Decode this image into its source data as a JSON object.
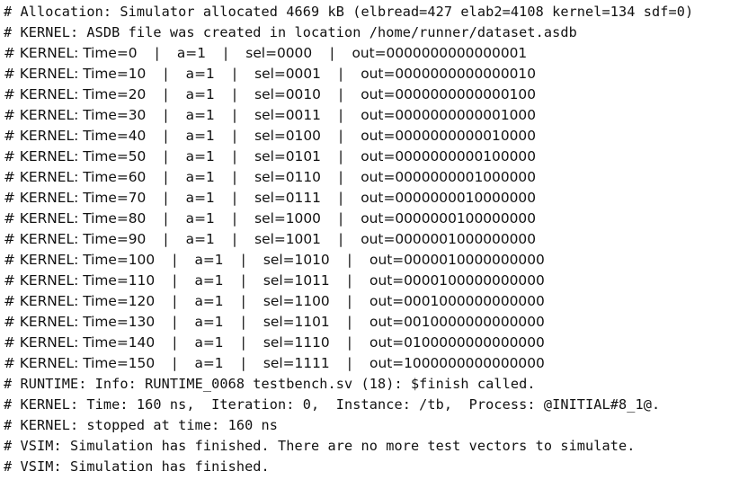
{
  "console": {
    "lines": [
      "# Allocation: Simulator allocated 4669 kB (elbread=427 elab2=4108 kernel=134 sdf=0)",
      "# KERNEL: ASDB file was created in location /home/runner/dataset.asdb",
      "# KERNEL: Time=0    |    a=1    |    sel=0000    |    out=0000000000000001",
      "# KERNEL: Time=10    |    a=1    |    sel=0001    |    out=0000000000000010",
      "# KERNEL: Time=20    |    a=1    |    sel=0010    |    out=0000000000000100",
      "# KERNEL: Time=30    |    a=1    |    sel=0011    |    out=0000000000001000",
      "# KERNEL: Time=40    |    a=1    |    sel=0100    |    out=0000000000010000",
      "# KERNEL: Time=50    |    a=1    |    sel=0101    |    out=0000000000100000",
      "# KERNEL: Time=60    |    a=1    |    sel=0110    |    out=0000000001000000",
      "# KERNEL: Time=70    |    a=1    |    sel=0111    |    out=0000000010000000",
      "# KERNEL: Time=80    |    a=1    |    sel=1000    |    out=0000000100000000",
      "# KERNEL: Time=90    |    a=1    |    sel=1001    |    out=0000001000000000",
      "# KERNEL: Time=100    |    a=1    |    sel=1010    |    out=0000010000000000",
      "# KERNEL: Time=110    |    a=1    |    sel=1011    |    out=0000100000000000",
      "# KERNEL: Time=120    |    a=1    |    sel=1100    |    out=0001000000000000",
      "# KERNEL: Time=130    |    a=1    |    sel=1101    |    out=0010000000000000",
      "# KERNEL: Time=140    |    a=1    |    sel=1110    |    out=0100000000000000",
      "# KERNEL: Time=150    |    a=1    |    sel=1111    |    out=1000000000000000",
      "# RUNTIME: Info: RUNTIME_0068 testbench.sv (18): $finish called.",
      "# KERNEL: Time: 160 ns,  Iteration: 0,  Instance: /tb,  Process: @INITIAL#8_1@.",
      "# KERNEL: stopped at time: 160 ns",
      "# VSIM: Simulation has finished. There are no more test vectors to simulate.",
      "# VSIM: Simulation has finished."
    ]
  }
}
